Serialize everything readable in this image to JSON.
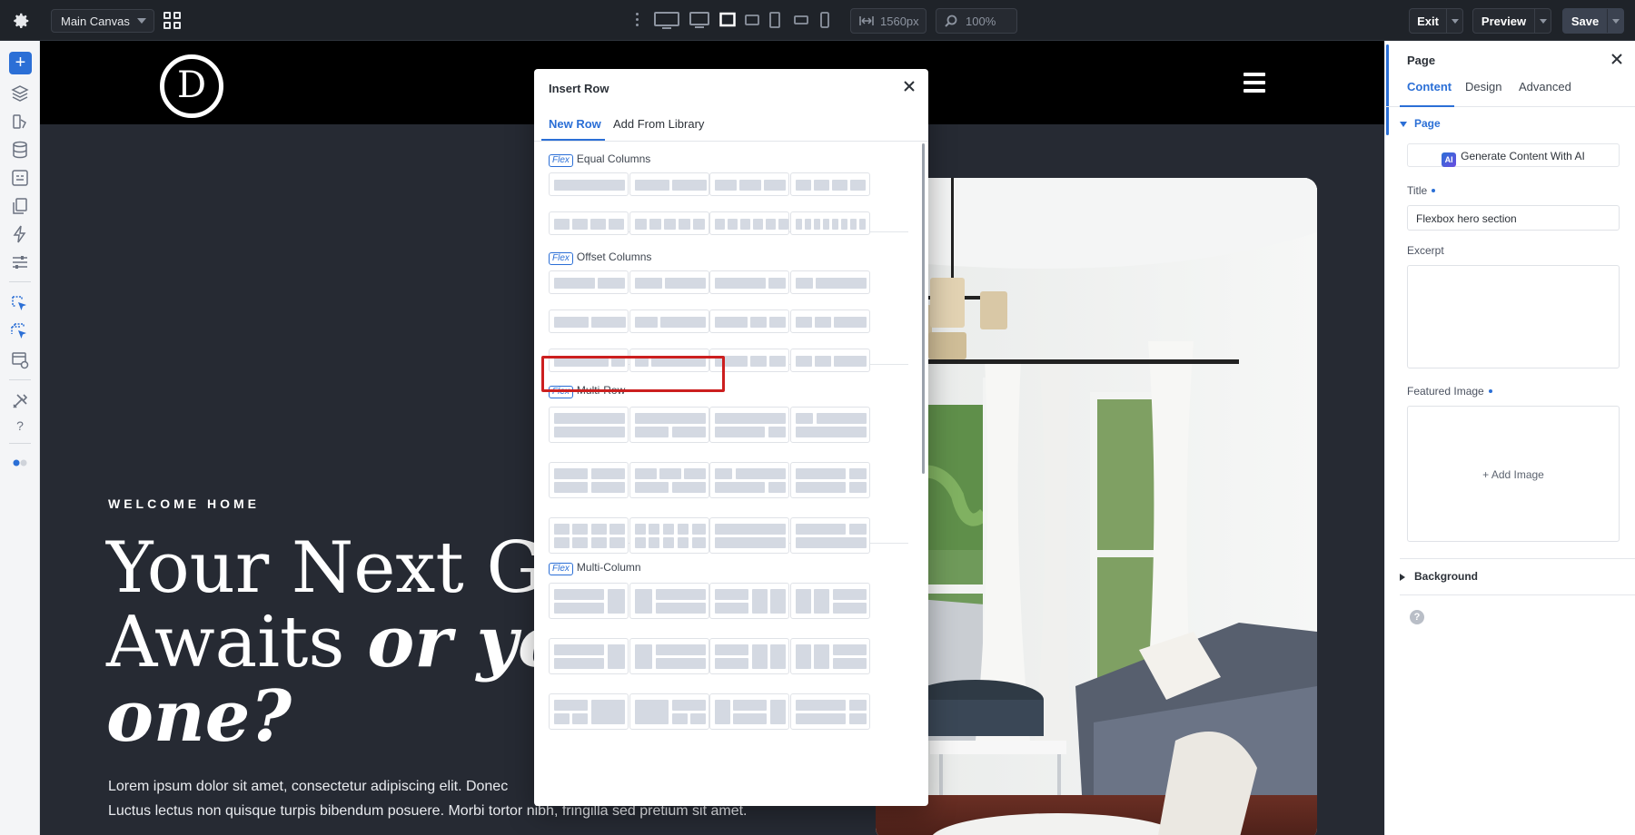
{
  "topbar": {
    "canvas_name": "Main Canvas",
    "width_value": "1560px",
    "zoom_value": "100%",
    "exit_label": "Exit",
    "preview_label": "Preview",
    "save_label": "Save"
  },
  "hero": {
    "eyebrow": "WELCOME HOME",
    "title_line1": "Your Next Geta",
    "title_line2_plain": "Awaits ",
    "title_line2_italic": "or your",
    "title_line3_italic": "one?",
    "body_line1": "Lorem ipsum dolor sit amet, consectetur adipiscing elit. Donec",
    "body_line2": "Luctus lectus non quisque turpis bibendum posuere. Morbi tortor nibh, fringilla sed pretium sit amet."
  },
  "modal": {
    "title": "Insert Row",
    "tabs": [
      "New Row",
      "Add From Library"
    ],
    "flex_tag": "Flex",
    "sections": [
      "Equal Columns",
      "Offset Columns",
      "Multi-Row",
      "Multi-Column"
    ]
  },
  "panel": {
    "title": "Page",
    "tabs": [
      "Content",
      "Design",
      "Advanced"
    ],
    "section_page": "Page",
    "ai_badge": "AI",
    "ai_button": "Generate Content With AI",
    "title_label": "Title",
    "title_value": "Flexbox hero section",
    "excerpt_label": "Excerpt",
    "excerpt_value": "",
    "featured_label": "Featured Image",
    "add_image": "+ Add Image",
    "section_background": "Background",
    "help": "?"
  },
  "colors": {
    "accent": "#2b6fd6",
    "highlight": "#cc1f1f",
    "canvas_bg": "#262a33"
  }
}
